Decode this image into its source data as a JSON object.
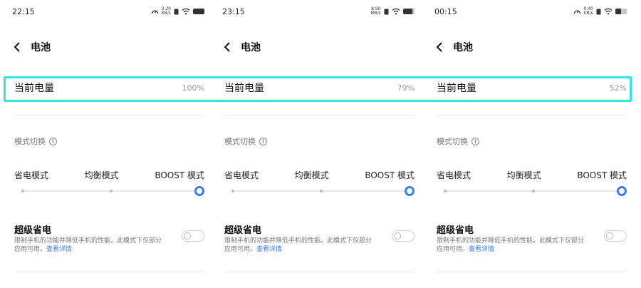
{
  "colors": {
    "accent": "#3b7df3",
    "highlight": "#2fe6e6",
    "muted_text": "#9a9a9a"
  },
  "panels": [
    {
      "status": {
        "time": "22:15",
        "net_speed": "3.20",
        "net_unit": "KB/s",
        "battery_level": 1.0
      },
      "header": {
        "title": "电池"
      },
      "battery_level": {
        "label": "当前电量",
        "value": "100%"
      },
      "mode": {
        "heading": "模式切换",
        "options": [
          "省电模式",
          "均衡模式",
          "BOOST 模式"
        ],
        "selected": "BOOST 模式"
      },
      "super_saver": {
        "title": "超级省电",
        "description": "限制手机的功能并降低手机的性能。此模式下仅部分应用可用。",
        "link": "查看详情",
        "enabled": false
      }
    },
    {
      "status": {
        "time": "23:15",
        "net_speed": "8.90",
        "net_unit": "MB/s",
        "battery_level": 0.79
      },
      "header": {
        "title": "电池"
      },
      "battery_level": {
        "label": "当前电量",
        "value": "79%"
      },
      "mode": {
        "heading": "模式切换",
        "options": [
          "省电模式",
          "均衡模式",
          "BOOST 模式"
        ],
        "selected": "BOOST 模式"
      },
      "super_saver": {
        "title": "超级省电",
        "description": "限制手机的功能并降低手机的性能。此模式下仅部分应用可用。",
        "link": "查看详情",
        "enabled": false
      }
    },
    {
      "status": {
        "time": "00:15",
        "net_speed": "0.40",
        "net_unit": "KB/s",
        "battery_level": 0.52
      },
      "header": {
        "title": "电池"
      },
      "battery_level": {
        "label": "当前电量",
        "value": "52%"
      },
      "mode": {
        "heading": "模式切换",
        "options": [
          "省电模式",
          "均衡模式",
          "BOOST 模式"
        ],
        "selected": "BOOST 模式"
      },
      "super_saver": {
        "title": "超级省电",
        "description": "限制手机的功能并降低手机的性能。此模式下仅部分应用可用。",
        "link": "查看详情",
        "enabled": false
      }
    }
  ]
}
